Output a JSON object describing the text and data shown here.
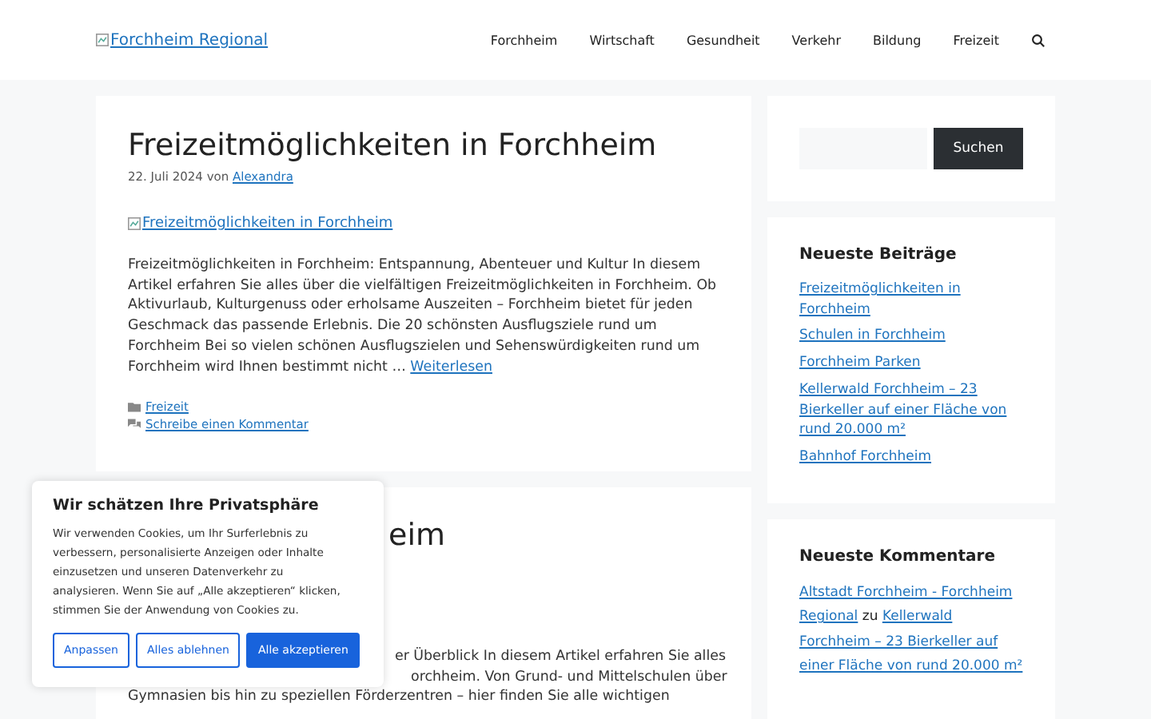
{
  "header": {
    "logo_alt": "Forchheim Regional",
    "nav": [
      {
        "label": "Forchheim"
      },
      {
        "label": "Wirtschaft"
      },
      {
        "label": "Gesundheit"
      },
      {
        "label": "Verkehr"
      },
      {
        "label": "Bildung"
      },
      {
        "label": "Freizeit"
      }
    ]
  },
  "articles": [
    {
      "title": "Freizeitmöglichkeiten in Forchheim",
      "date": "22. Juli 2024",
      "by": "von",
      "author": "Alexandra",
      "image_alt": "Freizeitmöglichkeiten in Forchheim",
      "excerpt": "Freizeitmöglichkeiten in Forchheim: Entspannung, Abenteuer und Kultur In diesem Artikel erfahren Sie alles über die vielfältigen Freizeitmöglichkeiten in Forchheim. Ob Aktivurlaub, Kulturgenuss oder erholsame Auszeiten – Forchheim bietet für jeden Geschmack das passende Erlebnis. Die 20 schönsten Ausflugsziele rund um Forchheim Bei so vielen schönen Ausflugszielen und Sehenswürdigkeiten rund um Forchheim wird Ihnen bestimmt nicht …",
      "more": "Weiterlesen",
      "category": "Freizeit",
      "comment_link": "Schreibe einen Kommentar"
    },
    {
      "title_visible": "eim",
      "lines": [
        "er Überblick In diesem Artikel erfahren Sie alles",
        "orchheim. Von Grund- und Mittelschulen über",
        "Gymnasien bis hin zu speziellen Förderzentren – hier finden Sie alle wichtigen"
      ]
    }
  ],
  "sidebar": {
    "search_button": "Suchen",
    "recent_posts": {
      "title": "Neueste Beiträge",
      "items": [
        "Freizeitmöglichkeiten in Forchheim",
        "Schulen in Forchheim",
        "Forchheim Parken",
        "Kellerwald Forchheim – 23 Bierkeller auf einer Fläche von rund 20.000 m²",
        "Bahnhof Forchheim"
      ]
    },
    "recent_comments": {
      "title": "Neueste Kommentare",
      "items": [
        {
          "author_lines": [
            "Altstadt Forchheim - Forchheim",
            "Regional"
          ],
          "joiner": "zu",
          "post_lines": [
            "Kellerwald",
            "Forchheim – 23 Bierkeller auf",
            "einer Fläche von rund 20.000 m²"
          ]
        }
      ]
    }
  },
  "cookie_banner": {
    "title": "Wir schätzen Ihre Privatsphäre",
    "text": "Wir verwenden Cookies, um Ihr Surferlebnis zu verbessern, personalisierte Anzeigen oder Inhalte einzusetzen und unseren Datenverkehr zu analysieren. Wenn Sie auf „Alle akzeptieren“ klicken, stimmen Sie der Anwendung von Cookies zu.",
    "buttons": [
      {
        "label": "Anpassen",
        "primary": false
      },
      {
        "label": "Alles ablehnen",
        "primary": false
      },
      {
        "label": "Alle akzeptieren",
        "primary": true
      }
    ]
  }
}
